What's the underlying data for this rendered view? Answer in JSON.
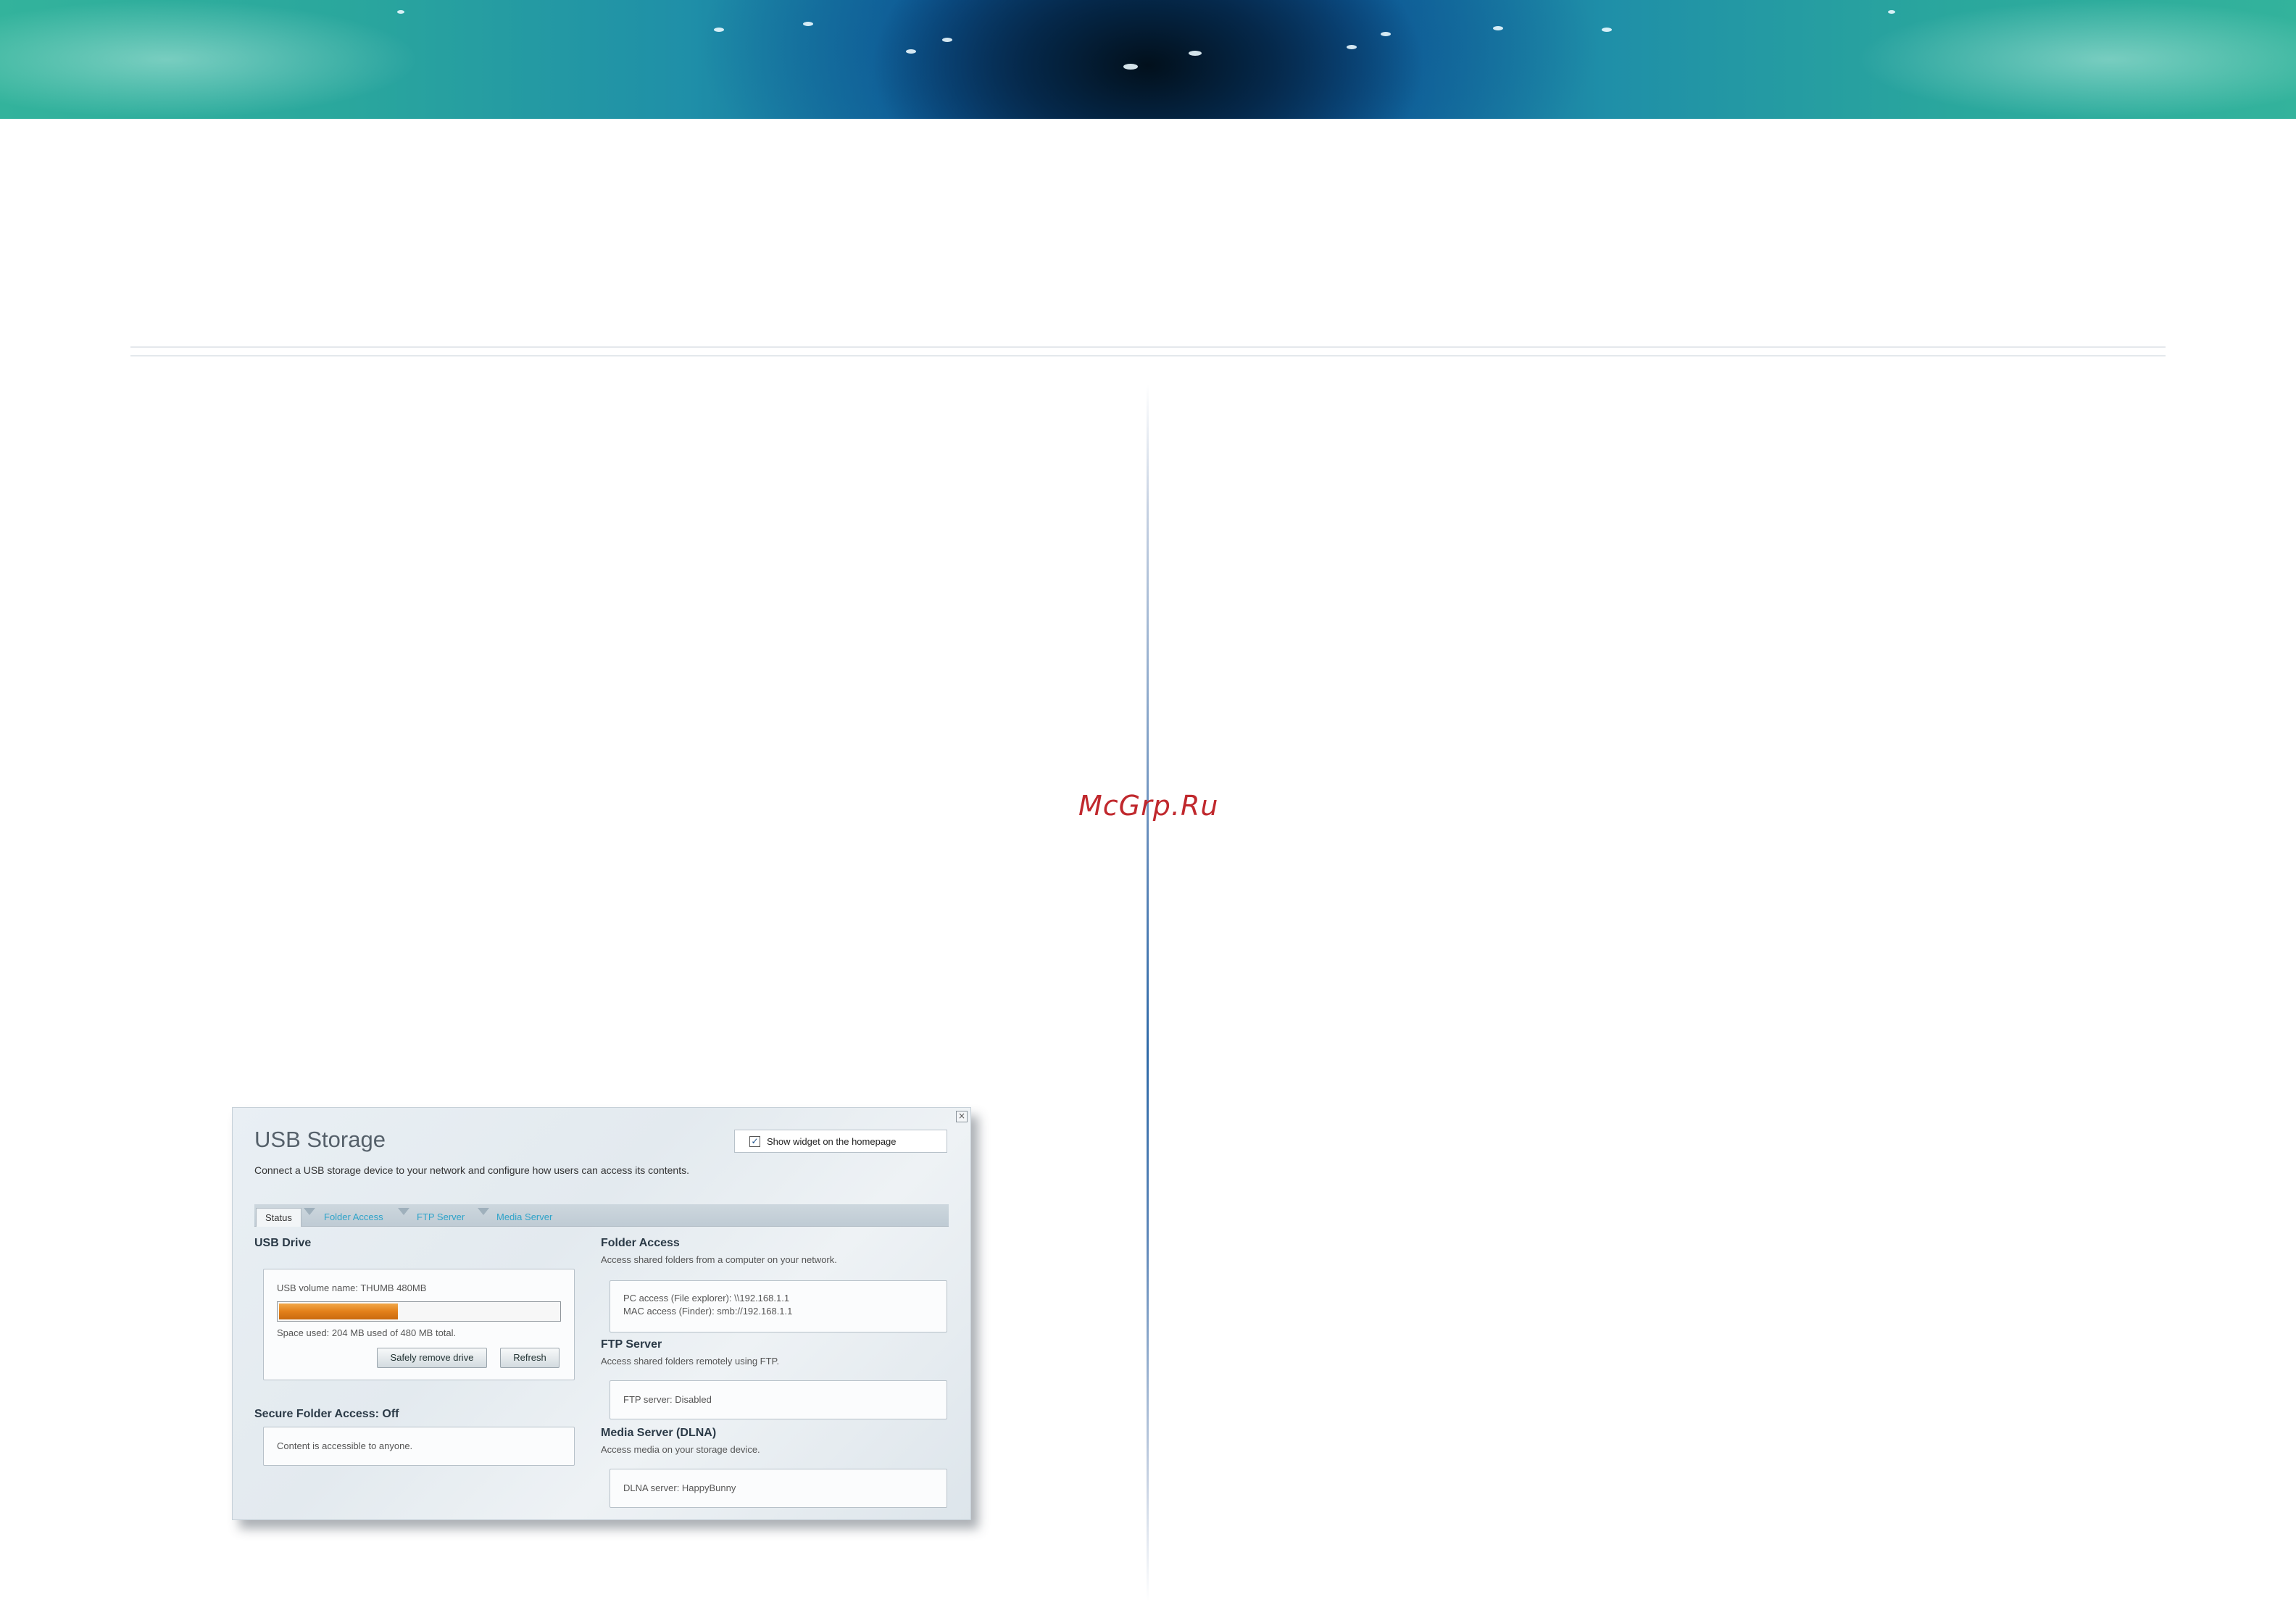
{
  "watermark": "McGrp.Ru",
  "panel": {
    "title": "USB Storage",
    "description": "Connect a USB storage device to your network and configure how users can access its contents.",
    "show_widget_label": "Show widget on the homepage",
    "show_widget_checked": true,
    "tabs": [
      {
        "label": "Status",
        "active": true
      },
      {
        "label": "Folder Access",
        "active": false
      },
      {
        "label": "FTP Server",
        "active": false
      },
      {
        "label": "Media Server",
        "active": false
      }
    ],
    "usb_drive": {
      "heading": "USB Drive",
      "volume_name": "USB volume name: THUMB 480MB",
      "usage_fraction": 0.425,
      "space_used": "Space used: 204 MB used of 480 MB total.",
      "remove_button": "Safely remove drive",
      "refresh_button": "Refresh"
    },
    "secure_folder": {
      "heading": "Secure Folder Access: Off",
      "text": "Content is accessible to anyone."
    },
    "folder_access": {
      "heading": "Folder Access",
      "subtitle": "Access shared folders from a computer on your network.",
      "pc_access": "PC access (File explorer): \\\\192.168.1.1",
      "mac_access": "MAC access (Finder): smb://192.168.1.1"
    },
    "ftp_server": {
      "heading": "FTP Server",
      "subtitle": "Access shared folders remotely using FTP.",
      "status": "FTP server: Disabled"
    },
    "media_server": {
      "heading": "Media Server (DLNA)",
      "subtitle": "Access media on your storage device.",
      "status": "DLNA server: HappyBunny"
    }
  }
}
